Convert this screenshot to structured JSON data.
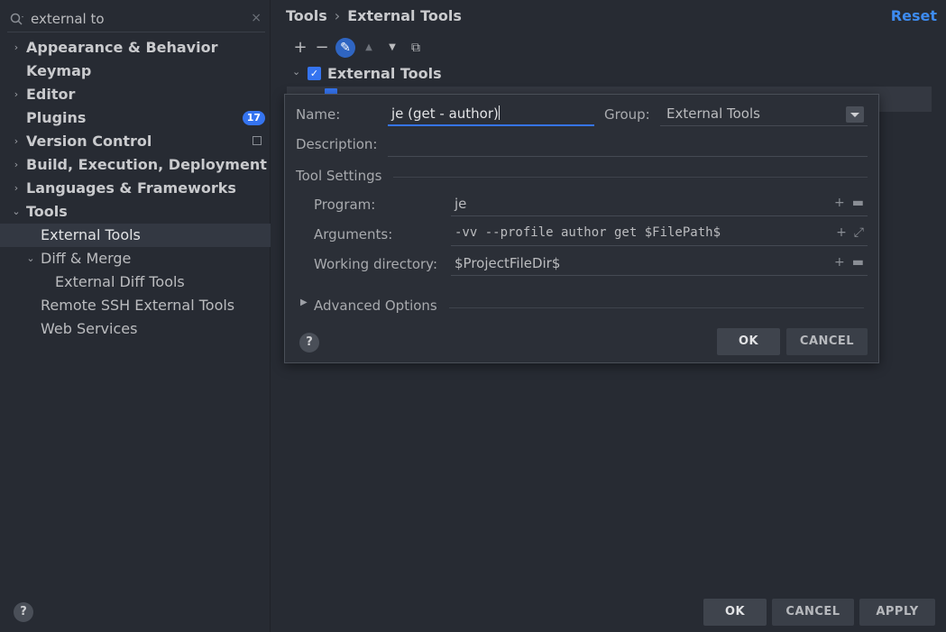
{
  "search": {
    "value": "external to",
    "clear_glyph": "×"
  },
  "sidebar": {
    "items": [
      {
        "label": "Appearance & Behavior"
      },
      {
        "label": "Keymap"
      },
      {
        "label": "Editor"
      },
      {
        "label": "Plugins",
        "badge": "17"
      },
      {
        "label": "Version Control"
      },
      {
        "label": "Build, Execution, Deployment"
      },
      {
        "label": "Languages & Frameworks"
      },
      {
        "label": "Tools"
      },
      {
        "label": "External Tools"
      },
      {
        "label": "Diff & Merge"
      },
      {
        "label": "External Diff Tools"
      },
      {
        "label": "Remote SSH External Tools"
      },
      {
        "label": "Web Services"
      }
    ]
  },
  "breadcrumb": {
    "parent": "Tools",
    "separator": "›",
    "current": "External Tools"
  },
  "header": {
    "reset_label": "Reset"
  },
  "toolbar": {
    "add": "+",
    "remove": "−",
    "edit": "✎",
    "up": "▲",
    "down": "▼",
    "copy": "⧉"
  },
  "tree": {
    "group_label": "External Tools",
    "check": "✓"
  },
  "dialog": {
    "name_label": "Name:",
    "name_value": "je (get - author)",
    "group_label": "Group:",
    "group_value": "External Tools",
    "description_label": "Description:",
    "description_value": "",
    "tool_settings_label": "Tool Settings",
    "program_label": "Program:",
    "program_value": "je",
    "arguments_label": "Arguments:",
    "arguments_value": "-vv --profile author get $FilePath$",
    "workdir_label": "Working directory:",
    "workdir_value": "$ProjectFileDir$",
    "advanced_label": "Advanced Options",
    "ok_label": "OK",
    "cancel_label": "CANCEL",
    "help_label": "?"
  },
  "footer": {
    "ok_label": "OK",
    "cancel_label": "CANCEL",
    "apply_label": "APPLY",
    "help_label": "?"
  },
  "colors": {
    "accent": "#3574f0",
    "link": "#3d8bf0",
    "background": "#272b33"
  }
}
